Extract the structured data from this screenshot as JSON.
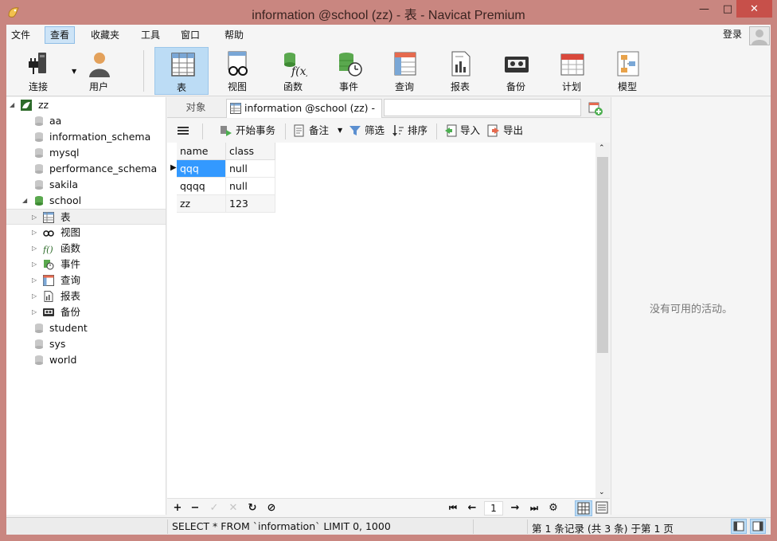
{
  "window": {
    "title": "information @school (zz) - 表 - Navicat Premium",
    "minimize_glyph": "—",
    "maximize_glyph": "□",
    "close_glyph": "✕"
  },
  "menubar": {
    "items": [
      "文件",
      "查看",
      "收藏夹",
      "工具",
      "窗口",
      "帮助"
    ],
    "active_index": 1,
    "login": "登录"
  },
  "toolbar": {
    "buttons": [
      {
        "label": "连接",
        "icon": "connection-plug-icon"
      },
      {
        "label": "用户",
        "icon": "user-icon"
      },
      {
        "label": "表",
        "icon": "table-icon"
      },
      {
        "label": "视图",
        "icon": "view-glasses-icon"
      },
      {
        "label": "函数",
        "icon": "function-icon"
      },
      {
        "label": "事件",
        "icon": "event-clock-icon"
      },
      {
        "label": "查询",
        "icon": "query-icon"
      },
      {
        "label": "报表",
        "icon": "report-icon"
      },
      {
        "label": "备份",
        "icon": "backup-tape-icon"
      },
      {
        "label": "计划",
        "icon": "schedule-calendar-icon"
      },
      {
        "label": "模型",
        "icon": "model-icon"
      }
    ],
    "active_label": "表"
  },
  "tree": {
    "connection": "zz",
    "databases": [
      "aa",
      "information_schema",
      "mysql",
      "performance_schema",
      "sakila",
      "school"
    ],
    "school_children": [
      {
        "label": "表",
        "icon": "table-icon"
      },
      {
        "label": "视图",
        "icon": "view-glasses-icon"
      },
      {
        "label": "函数",
        "icon": "function-icon"
      },
      {
        "label": "事件",
        "icon": "event-clock-icon"
      },
      {
        "label": "查询",
        "icon": "query-icon"
      },
      {
        "label": "报表",
        "icon": "report-icon"
      },
      {
        "label": "备份",
        "icon": "backup-tape-icon"
      }
    ],
    "more_databases": [
      "student",
      "sys",
      "world"
    ],
    "selected": "表"
  },
  "tabs": {
    "objects": "对象",
    "active": "information @school (zz) - 表"
  },
  "subtoolbar": {
    "begin_transaction": "开始事务",
    "comment": "备注",
    "filter": "筛选",
    "sort": "排序",
    "import": "导入",
    "export": "导出"
  },
  "grid": {
    "columns": [
      "name",
      "class"
    ],
    "rows": [
      [
        "qqq",
        "null"
      ],
      [
        "qqqq",
        "null"
      ],
      [
        "zz",
        "123"
      ]
    ],
    "selected_row": 0
  },
  "navbar": {
    "page": "1"
  },
  "rightpanel": {
    "no_activity": "没有可用的活动。"
  },
  "status": {
    "sql": "SELECT * FROM `information` LIMIT 0, 1000",
    "records": "第 1 条记录 (共 3 条) 于第 1 页"
  },
  "colors": {
    "frame": "#c98680",
    "selection": "#3399ff",
    "active_button": "#bcdcf5",
    "close_button": "#c7504a"
  }
}
